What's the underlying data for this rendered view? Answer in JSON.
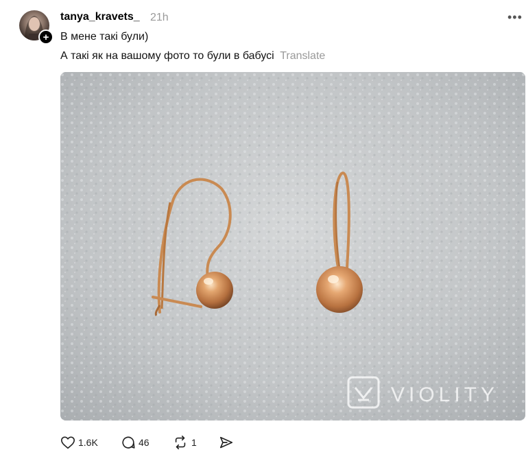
{
  "post": {
    "username": "tanya_kravets_",
    "timestamp": "21h",
    "more_label": "•••",
    "follow_badge": "+",
    "text_line1": "В мене такі були)",
    "text_line2": "А такі як на вашому фото то були в бабусі",
    "translate_label": "Translate",
    "image": {
      "watermark": "VIOLITY",
      "subject": "gold-ball-earrings"
    }
  },
  "actions": {
    "likes": "1.6K",
    "replies": "46",
    "reposts": "1"
  },
  "colors": {
    "text": "#000000",
    "muted": "#999999",
    "gold": "#c98a52"
  }
}
